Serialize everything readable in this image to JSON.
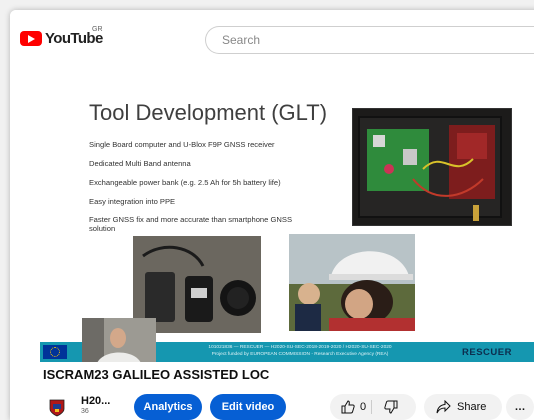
{
  "header": {
    "logo_text": "YouTube",
    "country_code": "GR",
    "search_placeholder": "Search"
  },
  "slide": {
    "title": "Tool Development (GLT)",
    "bullets": [
      "Single Board computer and U-Blox F9P GNSS receiver",
      "Dedicated Multi Band antenna",
      "Exchangeable power bank (e.g. 2.5 Ah for 5h battery life)",
      "Easy integration into PPE",
      "Faster GNSS fix and more accurate than smartphone GNSS solution"
    ],
    "footer_line1": "101021836 — RESCUER — H2020-SU-SEC-2018-2019-2020 / H2020-SU-SEC-2020",
    "footer_line2": "Project funded by EUROPEAN COMMISSION - Research Executive Agency (REA)",
    "rescuer_logo": "RESCUER"
  },
  "video": {
    "title": "ISCRAM23 GALILEO ASSISTED LOC"
  },
  "channel": {
    "name": "H20...",
    "subscribers": "36"
  },
  "actions": {
    "analytics_label": "Analytics",
    "edit_label": "Edit video",
    "like_count": "0",
    "share_label": "Share",
    "more_label": "…"
  },
  "colors": {
    "brand_red": "#ff0000",
    "button_blue": "#065fd4",
    "slide_strip": "#1597b0"
  },
  "icons": [
    "youtube-logo-icon",
    "like-icon",
    "dislike-icon",
    "share-icon",
    "more-icon",
    "channel-crest-icon"
  ]
}
